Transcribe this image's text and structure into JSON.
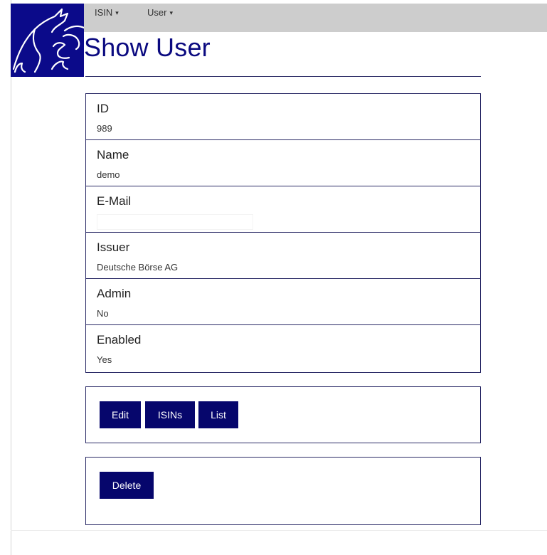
{
  "nav": {
    "items": [
      {
        "label": "ISIN",
        "caret": "▾"
      },
      {
        "label": "User",
        "caret": "▾"
      }
    ]
  },
  "logo": {
    "icon": "bull-bear-logo-icon",
    "background": "#0b0a8a"
  },
  "page": {
    "title": "Show User"
  },
  "user": {
    "fields": [
      {
        "label": "ID",
        "value": "989"
      },
      {
        "label": "Name",
        "value": "demo"
      },
      {
        "label": "E-Mail",
        "value": ""
      },
      {
        "label": "Issuer",
        "value": "Deutsche Börse AG"
      },
      {
        "label": "Admin",
        "value": "No"
      },
      {
        "label": "Enabled",
        "value": "Yes"
      }
    ]
  },
  "actions": {
    "edit_label": "Edit",
    "isins_label": "ISINs",
    "list_label": "List",
    "delete_label": "Delete"
  },
  "colors": {
    "accent": "#06066c",
    "title": "#0b0a80",
    "navbar": "#cdcdcd",
    "border": "#2a2a66"
  }
}
